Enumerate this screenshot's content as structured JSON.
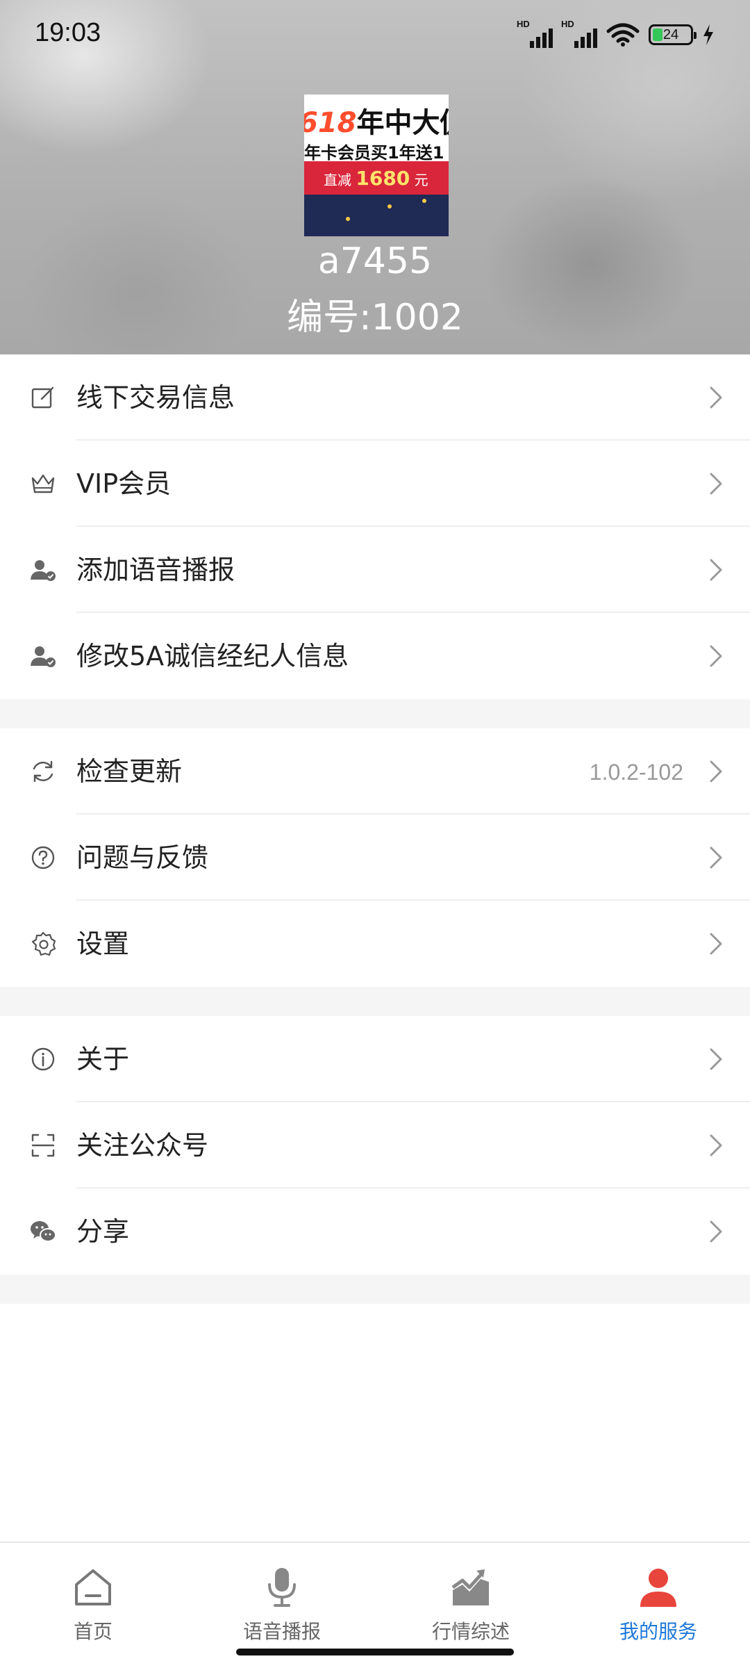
{
  "status_bar": {
    "time": "19:03",
    "battery_level": "24",
    "signal_label_1": "HD",
    "signal_label_2": "HD"
  },
  "profile": {
    "avatar": {
      "line1_number": "618",
      "line1_text": "年中大促",
      "line2": "年卡会员买1年送1",
      "banner_prefix": "直减",
      "banner_amount": "1680",
      "banner_suffix": "元"
    },
    "username": "a7455",
    "user_id": "编号:1002"
  },
  "groups": [
    {
      "items": [
        {
          "label": "线下交易信息",
          "icon": "edit-icon"
        },
        {
          "label": "VIP会员",
          "icon": "crown-icon"
        },
        {
          "label": "添加语音播报",
          "icon": "user-check-icon"
        },
        {
          "label": "修改5A诚信经纪人信息",
          "icon": "user-check-icon"
        }
      ]
    },
    {
      "items": [
        {
          "label": "检查更新",
          "value": "1.0.2-102",
          "icon": "refresh-icon"
        },
        {
          "label": "问题与反馈",
          "icon": "help-circle-icon"
        },
        {
          "label": "设置",
          "icon": "gear-icon"
        }
      ]
    },
    {
      "items": [
        {
          "label": "关于",
          "icon": "info-icon"
        },
        {
          "label": "关注公众号",
          "icon": "scan-icon"
        },
        {
          "label": "分享",
          "icon": "wechat-icon"
        }
      ]
    }
  ],
  "tabbar": {
    "tabs": [
      {
        "label": "首页",
        "icon": "home-icon",
        "active": false
      },
      {
        "label": "语音播报",
        "icon": "microphone-icon",
        "active": false
      },
      {
        "label": "行情综述",
        "icon": "trend-chart-icon",
        "active": false
      },
      {
        "label": "我的服务",
        "icon": "user-icon",
        "active": true
      }
    ],
    "active_color": "#1e78d8",
    "active_icon_color": "#e8453c",
    "inactive_color": "#666666"
  }
}
